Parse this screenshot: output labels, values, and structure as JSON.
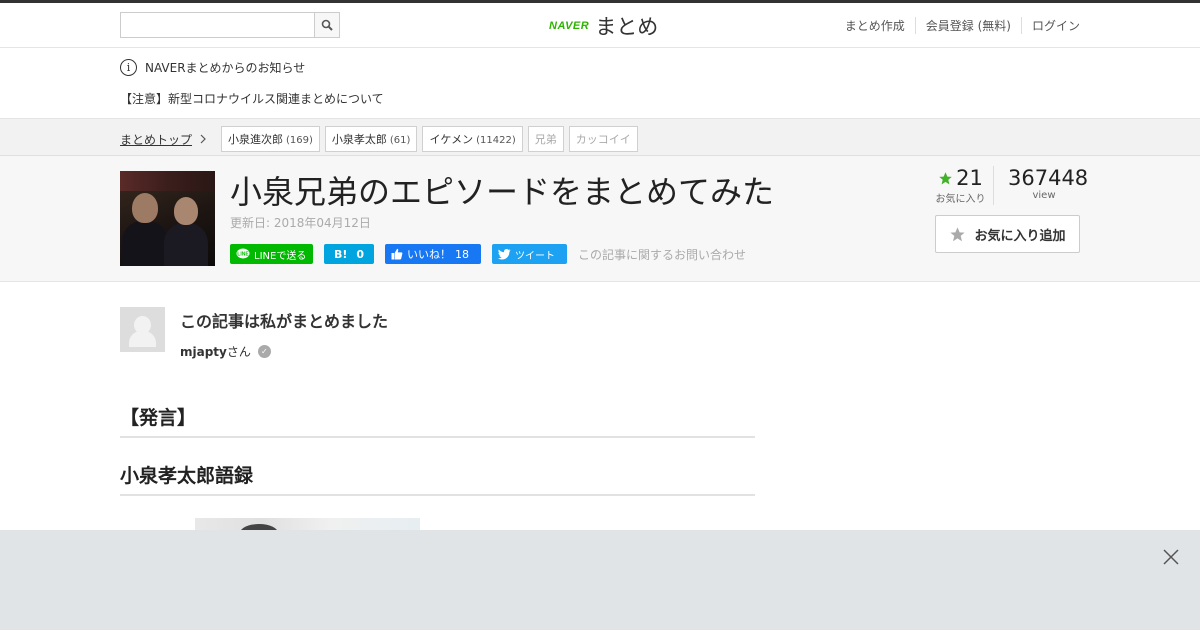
{
  "header": {
    "search_placeholder": "",
    "logo_naver": "NAVER",
    "logo_matome": "まとめ",
    "links": [
      "まとめ作成",
      "会員登録 (無料)",
      "ログイン"
    ]
  },
  "notice": {
    "heading": "NAVERまとめからのお知らせ",
    "link": "【注意】新型コロナウイルス関連まとめについて"
  },
  "breadcrumb": {
    "top": "まとめトップ",
    "tags": [
      {
        "label": "小泉進次郎",
        "count": "(169)"
      },
      {
        "label": "小泉孝太郎",
        "count": "(61)"
      },
      {
        "label": "イケメン",
        "count": "(11422)"
      },
      {
        "label": "兄弟",
        "count": ""
      },
      {
        "label": "カッコイイ",
        "count": ""
      }
    ]
  },
  "article": {
    "title": "小泉兄弟のエピソードをまとめてみた",
    "updated": "更新日: 2018年04月12日",
    "share": {
      "line": "LINEで送る",
      "hatena_count": "0",
      "fb_like": "いいね！",
      "fb_count": "18",
      "tweet": "ツイート",
      "contact": "この記事に関するお問い合わせ"
    },
    "favorites": "21",
    "favorites_label": "お気に入り",
    "views": "367448",
    "views_label": "view",
    "fav_button": "お気に入り追加"
  },
  "author": {
    "heading": "この記事は私がまとめました",
    "name": "mjapty",
    "suffix": "さん"
  },
  "sections": {
    "h1": "【発言】",
    "h2": "小泉孝太郎語録"
  },
  "colors": {
    "naver_green": "#2db400",
    "line_green": "#00b900",
    "hatena_blue": "#00a4de",
    "facebook_blue": "#1877f2",
    "twitter_blue": "#1da1f2",
    "star_green": "#43b02a"
  }
}
